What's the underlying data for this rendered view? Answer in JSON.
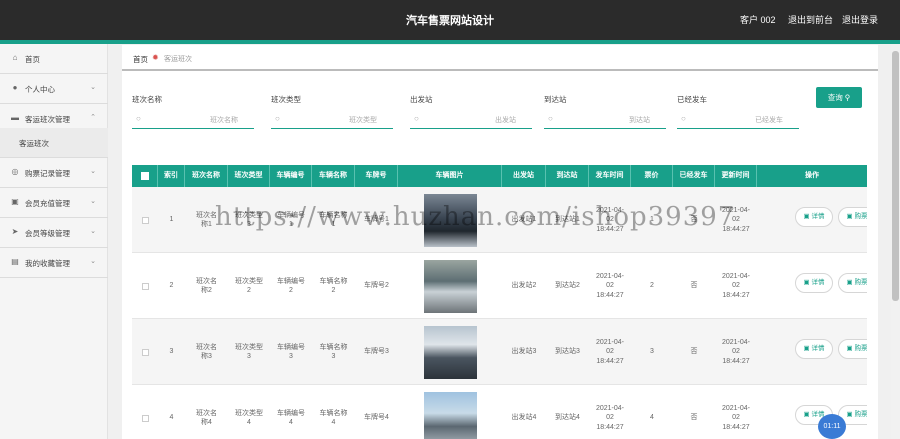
{
  "header": {
    "title": "汽车售票网站设计",
    "user": "客户 002",
    "back_to_admin": "退出到前台",
    "logout": "退出登录"
  },
  "colors": {
    "accent": "#18a08a",
    "topbar": "#2b2b2b"
  },
  "sidebar": {
    "items": [
      {
        "label": "首页",
        "icon": "home-icon"
      },
      {
        "label": "个人中心",
        "icon": "user-icon"
      },
      {
        "label": "客运班次管理",
        "icon": "bus-icon",
        "expanded": true
      },
      {
        "label": "购票记录管理",
        "icon": "ticket-icon"
      },
      {
        "label": "会员充值管理",
        "icon": "wallet-icon"
      },
      {
        "label": "会员等级管理",
        "icon": "rank-icon"
      },
      {
        "label": "我的收藏管理",
        "icon": "favorite-icon"
      }
    ],
    "subitem": "客运班次"
  },
  "breadcrumb": {
    "home": "首页",
    "current": "客运班次"
  },
  "filters": [
    {
      "label": "班次名称",
      "placeholder": "班次名称"
    },
    {
      "label": "班次类型",
      "placeholder": "班次类型"
    },
    {
      "label": "出发站",
      "placeholder": "出发站"
    },
    {
      "label": "到达站",
      "placeholder": "到达站"
    },
    {
      "label": "已经发车",
      "placeholder": "已经发车"
    }
  ],
  "query_button": "查询",
  "table": {
    "headers": [
      "索引",
      "班次名称",
      "班次类型",
      "车辆编号",
      "车辆名称",
      "车牌号",
      "车辆图片",
      "出发站",
      "到达站",
      "发车时间",
      "票价",
      "已经发车",
      "更新时间",
      "操作"
    ],
    "rows": [
      {
        "index": "1",
        "name": "班次名称1",
        "type": "班次类型3",
        "vehicle_no": "车辆编号1",
        "vehicle_name": "车辆名称1",
        "plate": "车牌号1",
        "from": "出发站1",
        "to": "到达站1",
        "depart": "2021-04-02 18:44:27",
        "price": "1",
        "departed": "否",
        "updated": "2021-04-02 18:44:27"
      },
      {
        "index": "2",
        "name": "班次名称2",
        "type": "班次类型2",
        "vehicle_no": "车辆编号2",
        "vehicle_name": "车辆名称2",
        "plate": "车牌号2",
        "from": "出发站2",
        "to": "到达站2",
        "depart": "2021-04-02 18:44:27",
        "price": "2",
        "departed": "否",
        "updated": "2021-04-02 18:44:27"
      },
      {
        "index": "3",
        "name": "班次名称3",
        "type": "班次类型3",
        "vehicle_no": "车辆编号3",
        "vehicle_name": "车辆名称3",
        "plate": "车牌号3",
        "from": "出发站3",
        "to": "到达站3",
        "depart": "2021-04-02 18:44:27",
        "price": "3",
        "departed": "否",
        "updated": "2021-04-02 18:44:27"
      },
      {
        "index": "4",
        "name": "班次名称4",
        "type": "班次类型4",
        "vehicle_no": "车辆编号4",
        "vehicle_name": "车辆名称4",
        "plate": "车牌号4",
        "from": "出发站4",
        "to": "到达站4",
        "depart": "2021-04-02 18:44:27",
        "price": "4",
        "departed": "否",
        "updated": "2021-04-02 18:44:27"
      }
    ],
    "detail_label": "详情",
    "cart_label": "购票"
  },
  "watermark": "https://www.huzhan.com/ishop39397",
  "chat_bubble": "01:11"
}
